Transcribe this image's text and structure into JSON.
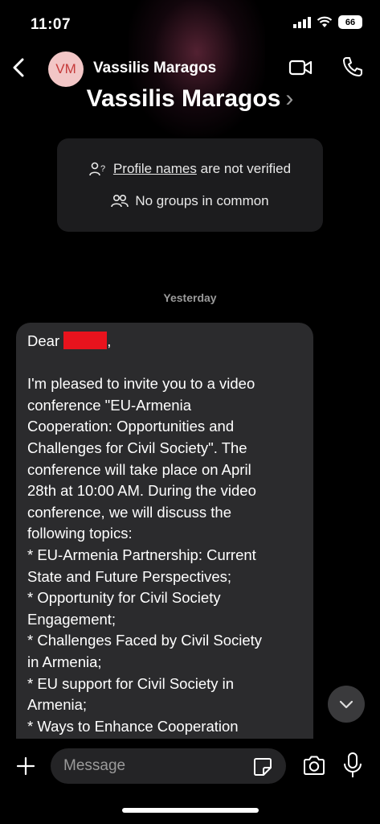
{
  "status_bar": {
    "time": "11:07",
    "battery": "66"
  },
  "header": {
    "avatar_initials": "VM",
    "contact_name": "Vassilis Maragos"
  },
  "profile": {
    "name": "Vassilis Maragos",
    "chevron": "›"
  },
  "info_card": {
    "profile_link": "Profile names",
    "profile_suffix": "are not verified",
    "groups": "No groups in common"
  },
  "date_divider": "Yesterday",
  "message": {
    "greeting_prefix": "Dear ",
    "greeting_suffix": ",",
    "lines": [
      "I'm pleased to invite you to a video",
      "conference \"EU-Armenia",
      "Cooperation: Opportunities and",
      "Challenges for Civil Society\". The",
      "conference will take place on April",
      "28th at 10:00 AM. During the video",
      "conference, we will discuss the",
      "following topics:",
      "* EU-Armenia Partnership: Current",
      "State and Future Perspectives;",
      "* Opportunity for Civil Society",
      "Engagement;",
      "* Challenges Faced by Civil Society",
      "in Armenia;",
      "* EU support for Civil Society in",
      "Armenia;",
      "* Ways to Enhance Cooperation"
    ]
  },
  "composer": {
    "placeholder": "Message"
  },
  "icons": {
    "back": "back-chevron-icon",
    "video": "video-camera-icon",
    "call": "phone-icon",
    "person_question": "person-question-icon",
    "group": "group-icon",
    "scroll_down": "chevron-down-icon",
    "plus": "plus-icon",
    "sticker": "sticker-icon",
    "camera": "camera-icon",
    "mic": "microphone-icon"
  },
  "colors": {
    "background": "#000000",
    "bubble": "#2b2b2d",
    "card": "#1c1c1e",
    "avatar_bg": "#f2c6c6",
    "avatar_text": "#c53a3a",
    "redaction": "#e8131d"
  }
}
